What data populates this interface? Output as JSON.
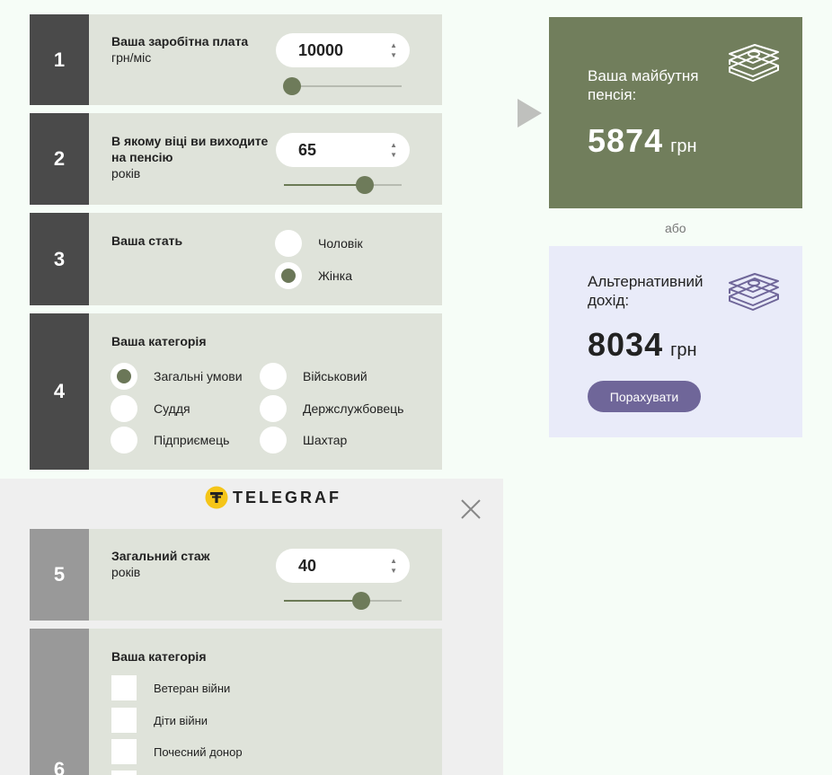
{
  "colors": {
    "result_bg": "#717e5c",
    "alt_bg": "#e9ebf9",
    "accent_dark": "#4a4a4a",
    "thumb": "#6e7b5a",
    "button": "#6f6699"
  },
  "steps": {
    "s1": {
      "num": "1",
      "title": "Ваша заробітна плата",
      "sub": "грн/міс",
      "value": "10000",
      "slider_fraction": 0.07
    },
    "s2": {
      "num": "2",
      "title": "В якому віці ви виходите на пенсію",
      "sub": "років",
      "value": "65",
      "slider_fraction": 0.69
    },
    "s3": {
      "num": "3",
      "title": "Ваша стать",
      "options": [
        "Чоловік",
        "Жінка"
      ],
      "selected": "Жінка"
    },
    "s4": {
      "num": "4",
      "title": "Ваша категорія",
      "options": [
        "Загальні умови",
        "Військовий",
        "Суддя",
        "Держслужбовець",
        "Підприємець",
        "Шахтар"
      ],
      "selected": "Загальні умови"
    },
    "s5": {
      "num": "5",
      "title": "Загальний стаж",
      "sub": "років",
      "value": "40",
      "slider_fraction": 0.66
    },
    "s6": {
      "num": "6",
      "title": "Ваша категорія",
      "options": [
        "Ветеран війни",
        "Діти війни",
        "Почесний донор"
      ]
    }
  },
  "ad": {
    "brand": "TELEGRAF",
    "close_icon": "close-icon"
  },
  "result": {
    "caption": "Ваша майбутня пенсія:",
    "value": "5874",
    "unit": "грн",
    "icon": "money-stack-icon"
  },
  "separator": "або",
  "alternative": {
    "caption": "Альтернативний дохід:",
    "value": "8034",
    "unit": "грн",
    "button": "Порахувати",
    "icon": "money-stack-icon"
  }
}
